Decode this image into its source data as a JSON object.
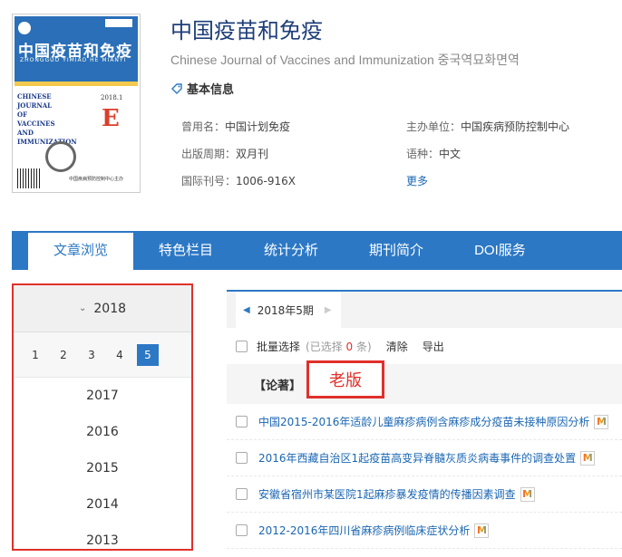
{
  "journal": {
    "title": "中国疫苗和免疫",
    "english_title": "Chinese Journal of Vaccines and Immunization 중국역묘화면역",
    "basic_info_label": "基本信息",
    "cover": {
      "cn_title": "中国疫苗和免疫",
      "pinyin": "ZHONGGUO YIMIAO HE MIANYI",
      "en_lines": [
        "CHINESE",
        "JOURNAL",
        "OF",
        "VACCINES",
        "AND",
        "IMMUNIZATION"
      ],
      "year_issue": "2018.1",
      "logo_letter": "E",
      "publisher": "中国疾病预防控制中心主办"
    },
    "info": {
      "former_name_label": "曾用名：",
      "former_name": "中国计划免疫",
      "sponsor_label": "主办单位：",
      "sponsor": "中国疾病预防控制中心",
      "period_label": "出版周期：",
      "period": "双月刊",
      "language_label": "语种：",
      "language": "中文",
      "issn_label": "国际刊号：",
      "issn": "1006-916X",
      "more_label": "更多"
    }
  },
  "nav": {
    "items": [
      "文章浏览",
      "特色栏目",
      "统计分析",
      "期刊简介",
      "DOI服务"
    ]
  },
  "sidebar": {
    "current_year": "2018",
    "issues": [
      "1",
      "2",
      "3",
      "4",
      "5"
    ],
    "active_issue": "5",
    "years": [
      "2017",
      "2016",
      "2015",
      "2014",
      "2013"
    ]
  },
  "content": {
    "tab_label": "2018年5期",
    "toolbar": {
      "batch_select": "批量选择",
      "selected_prefix": "(已选择",
      "selected_count": "0",
      "selected_suffix": "条)",
      "clear": "清除",
      "export": "导出"
    },
    "section_label": "【论著】",
    "annotation": "老版",
    "articles": [
      "中国2015-2016年适龄儿童麻疹病例含麻疹成分疫苗未接种原因分析",
      "2016年西藏自治区1起疫苗高变异脊髓灰质炎病毒事件的调查处置",
      "安徽省宿州市某医院1起麻疹暴发疫情的传播因素调查",
      "2012-2016年四川省麻疹病例临床症状分析"
    ],
    "badge_letter": "M"
  }
}
